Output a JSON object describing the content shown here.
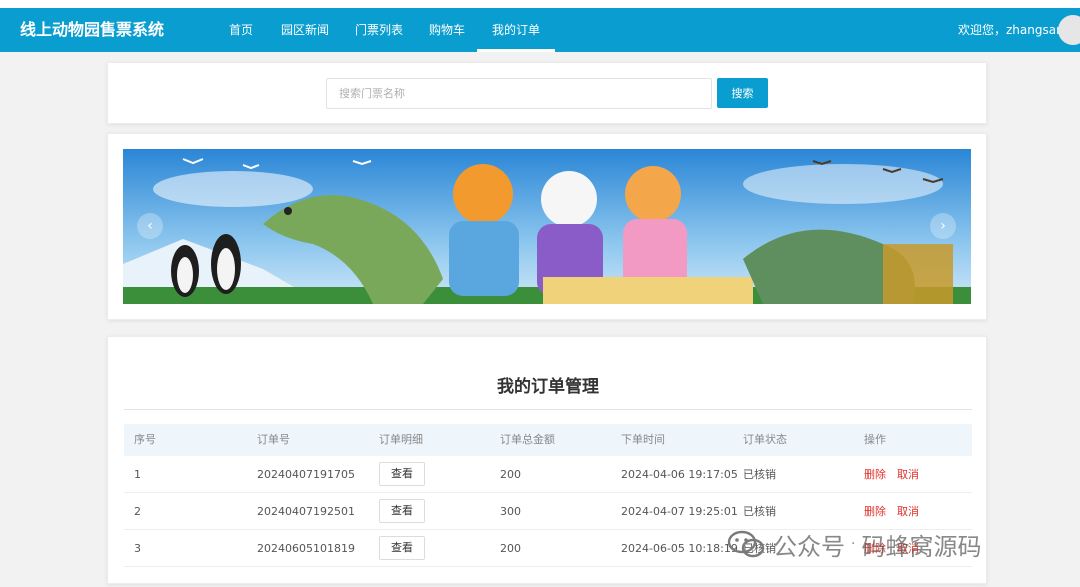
{
  "app": {
    "title": "线上动物园售票系统"
  },
  "nav": {
    "items": [
      {
        "label": "首页"
      },
      {
        "label": "园区新闻"
      },
      {
        "label": "门票列表"
      },
      {
        "label": "购物车"
      },
      {
        "label": "我的订单"
      }
    ],
    "active": "我的订单",
    "welcome": "欢迎您，zhangsan"
  },
  "search": {
    "placeholder": "搜索门票名称",
    "button_label": "搜索"
  },
  "banner": {
    "prev_icon": "chevron-left-icon",
    "next_icon": "chevron-right-icon"
  },
  "orders": {
    "title": "我的订单管理",
    "columns": [
      "序号",
      "订单号",
      "订单明细",
      "订单总金额",
      "下单时间",
      "订单状态",
      "操作"
    ],
    "rows": [
      {
        "index": "1",
        "order_no": "20240407191705",
        "detail": "查看",
        "amount": "200",
        "time": "2024-04-06 19:17:05",
        "status": "已核销",
        "delete": "删除",
        "cancel": "取消"
      },
      {
        "index": "2",
        "order_no": "20240407192501",
        "detail": "查看",
        "amount": "300",
        "time": "2024-04-07 19:25:01",
        "status": "已核销",
        "delete": "删除",
        "cancel": "取消"
      },
      {
        "index": "3",
        "order_no": "20240605101819",
        "detail": "查看",
        "amount": "200",
        "time": "2024-06-05 10:18:19",
        "status": "已核销",
        "delete": "删除",
        "cancel": "取消"
      }
    ]
  },
  "watermark": {
    "text": "公众号",
    "separator": "·",
    "name": "码蜂窝源码"
  },
  "colors": {
    "primary": "#0a9ed0",
    "danger": "#e0302a",
    "header_bg": "#eef6fb"
  }
}
